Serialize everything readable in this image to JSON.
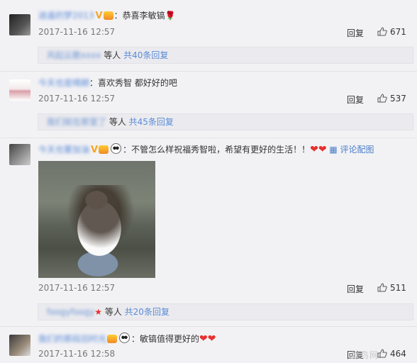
{
  "comments": [
    {
      "username": "逍遥的梦2013",
      "text": "：恭喜李敏镐",
      "date": "2017-11-16 12:57",
      "reply_label": "回复",
      "likes": "671",
      "replies": {
        "user": "风起云散xxxx",
        "suffix": " 等人 ",
        "count_label": "共40条回复"
      }
    },
    {
      "username": "今天也是晴朗",
      "text": "：喜欢秀智 都好好的吧",
      "date": "2017-11-16 12:57",
      "reply_label": "回复",
      "likes": "537",
      "replies": {
        "user": "我们就在那里了",
        "suffix": " 等人 ",
        "count_label": "共45条回复"
      }
    },
    {
      "username": "今天也要加油",
      "text": "：不管怎么样祝福秀智啦，希望有更好的生活！！",
      "link_label": "评论配图",
      "date": "2017-11-16 12:57",
      "reply_label": "回复",
      "likes": "511",
      "replies": {
        "user": "foogyfoogy",
        "suffix": " 等人 ",
        "count_label": "共20条回复"
      }
    },
    {
      "username": "我们的那段旧时光",
      "text": "：敏镐值得更好的",
      "date": "2017-11-16 12:58",
      "reply_label": "回复",
      "likes": "464"
    }
  ],
  "watermark": "蜂鸟网"
}
